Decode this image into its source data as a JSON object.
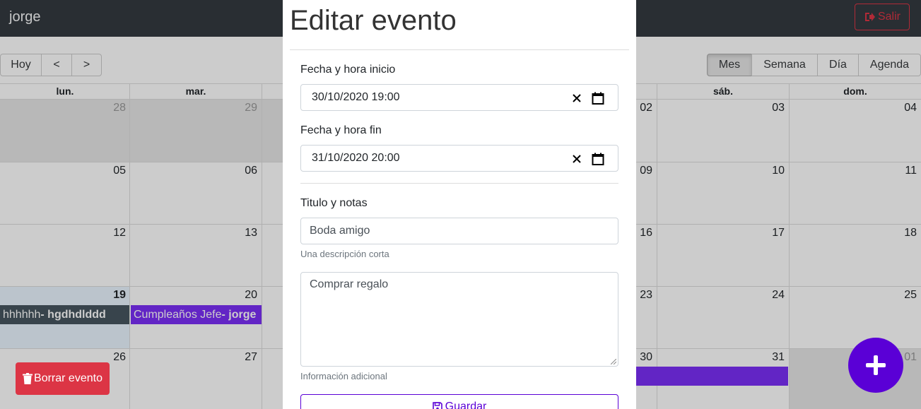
{
  "navbar": {
    "user_name": "jorge",
    "logout_label": "Salir"
  },
  "toolbar": {
    "today_label": "Hoy",
    "prev_label": "<",
    "next_label": ">",
    "views": [
      "Mes",
      "Semana",
      "Día",
      "Agenda"
    ],
    "active_view": "Mes"
  },
  "calendar": {
    "day_headers": [
      "lun.",
      "mar.",
      "",
      "",
      "",
      "sáb.",
      "dom."
    ],
    "weeks": [
      [
        "28",
        "29",
        "",
        "",
        "02",
        "03",
        "04"
      ],
      [
        "05",
        "06",
        "",
        "",
        "09",
        "10",
        "11"
      ],
      [
        "12",
        "13",
        "",
        "",
        "16",
        "17",
        "18"
      ],
      [
        "19",
        "20",
        "",
        "",
        "23",
        "24",
        "25"
      ],
      [
        "26",
        "27",
        "",
        "",
        "30",
        "31",
        "01"
      ]
    ],
    "events": [
      {
        "title": "hhhhhh",
        "user": "hgdhdlddd",
        "color": "#465660"
      },
      {
        "title": "Cumpleaños Jefe",
        "user": "jorge",
        "color": "#7b2ff7"
      },
      {
        "title": "",
        "user": "",
        "color": "#7b2ff7"
      }
    ]
  },
  "modal": {
    "title": "Editar evento",
    "start_label": "Fecha y hora inicio",
    "start_value": "30/10/2020  19:00",
    "end_label": "Fecha y hora fin",
    "end_value": "31/10/2020  20:00",
    "title_label": "Titulo y notas",
    "title_value": "Boda amigo",
    "title_help": "Una descripción corta",
    "notes_value": "Comprar regalo",
    "notes_help": "Información adicional",
    "save_label": "Guardar"
  },
  "delete_label": "Borrar evento",
  "colors": {
    "primary": "#5a00d6",
    "danger": "#dc3545",
    "navbar": "#343a40"
  }
}
